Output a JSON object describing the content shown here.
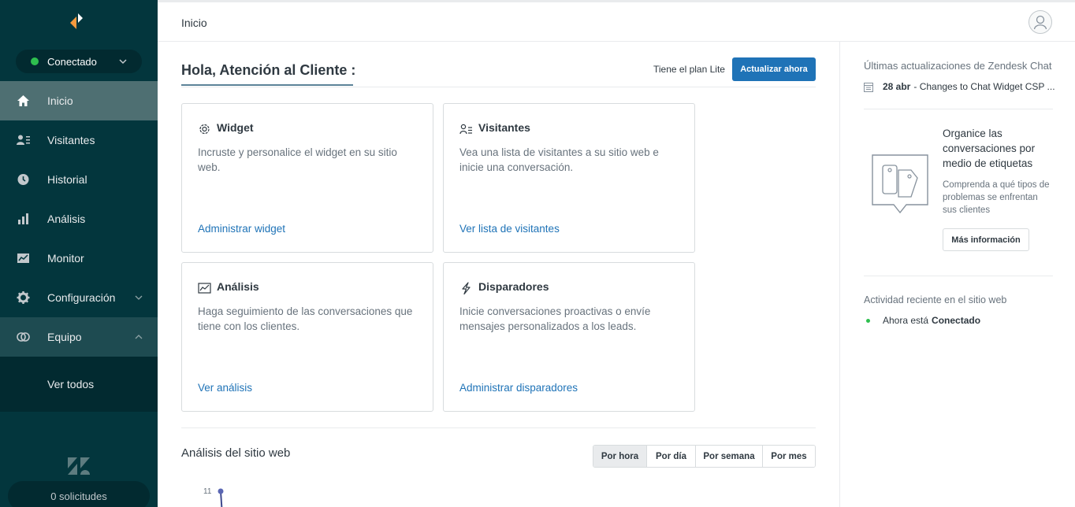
{
  "colors": {
    "sidebar_bg": "#03363d",
    "sidebar_active": "#4e6f72",
    "accent_blue": "#1f73b7",
    "status_green": "#2ebf4f",
    "logo_orange": "#f79a3e"
  },
  "sidebar": {
    "status": {
      "label": "Conectado",
      "icon": "chevron-down-icon"
    },
    "items": [
      {
        "label": "Inicio",
        "icon": "home-icon",
        "active": true
      },
      {
        "label": "Visitantes",
        "icon": "visitors-icon"
      },
      {
        "label": "Historial",
        "icon": "clock-icon"
      },
      {
        "label": "Análisis",
        "icon": "bar-chart-icon"
      },
      {
        "label": "Monitor",
        "icon": "monitor-icon"
      },
      {
        "label": "Configuración",
        "icon": "gear-icon",
        "chevron": "chevron-down-icon"
      },
      {
        "label": "Equipo",
        "icon": "team-icon",
        "chevron": "chevron-up-icon",
        "expanded": true
      }
    ],
    "subitem": "Ver todos",
    "tickets": "0 solicitudes"
  },
  "topbar": {
    "breadcrumb": "Inicio"
  },
  "main": {
    "greeting": "Hola, Atención al Cliente :",
    "plan_text": "Tiene el plan Lite",
    "upgrade_label": "Actualizar ahora",
    "cards": [
      {
        "title": "Widget",
        "icon": "gear-icon",
        "desc": "Incruste y personalice el widget en su sitio web.",
        "link": "Administrar widget"
      },
      {
        "title": "Visitantes",
        "icon": "visitors-list-icon",
        "desc": "Vea una lista de visitantes a su sitio web e inicie una conversación.",
        "link": "Ver lista de visitantes"
      },
      {
        "title": "Análisis",
        "icon": "line-chart-icon",
        "desc": "Haga seguimiento de las conversaciones que tiene con los clientes.",
        "link": "Ver análisis"
      },
      {
        "title": "Disparadores",
        "icon": "lightning-icon",
        "desc": "Inicie conversaciones proactivas o envíe mensajes personalizados a los leads.",
        "link": "Administrar disparadores"
      }
    ],
    "analysis": {
      "title": "Análisis del sitio web",
      "periods": [
        {
          "label": "Por hora",
          "selected": true
        },
        {
          "label": "Por día"
        },
        {
          "label": "Por semana"
        },
        {
          "label": "Por mes"
        }
      ],
      "y_tick": "11"
    }
  },
  "right_panel": {
    "updates_title": "Últimas actualizaciones de Zendesk Chat",
    "update": {
      "date": "28 abr",
      "text": "- Changes to Chat Widget CSP ..."
    },
    "promo": {
      "title": "Organice las conversaciones por medio de etiquetas",
      "desc": "Comprenda a qué tipos de problemas se enfrentan sus clientes",
      "button": "Más información"
    },
    "activity_title": "Actividad reciente en el sitio web",
    "activity": {
      "prefix": "Ahora está",
      "status": "Conectado"
    }
  }
}
